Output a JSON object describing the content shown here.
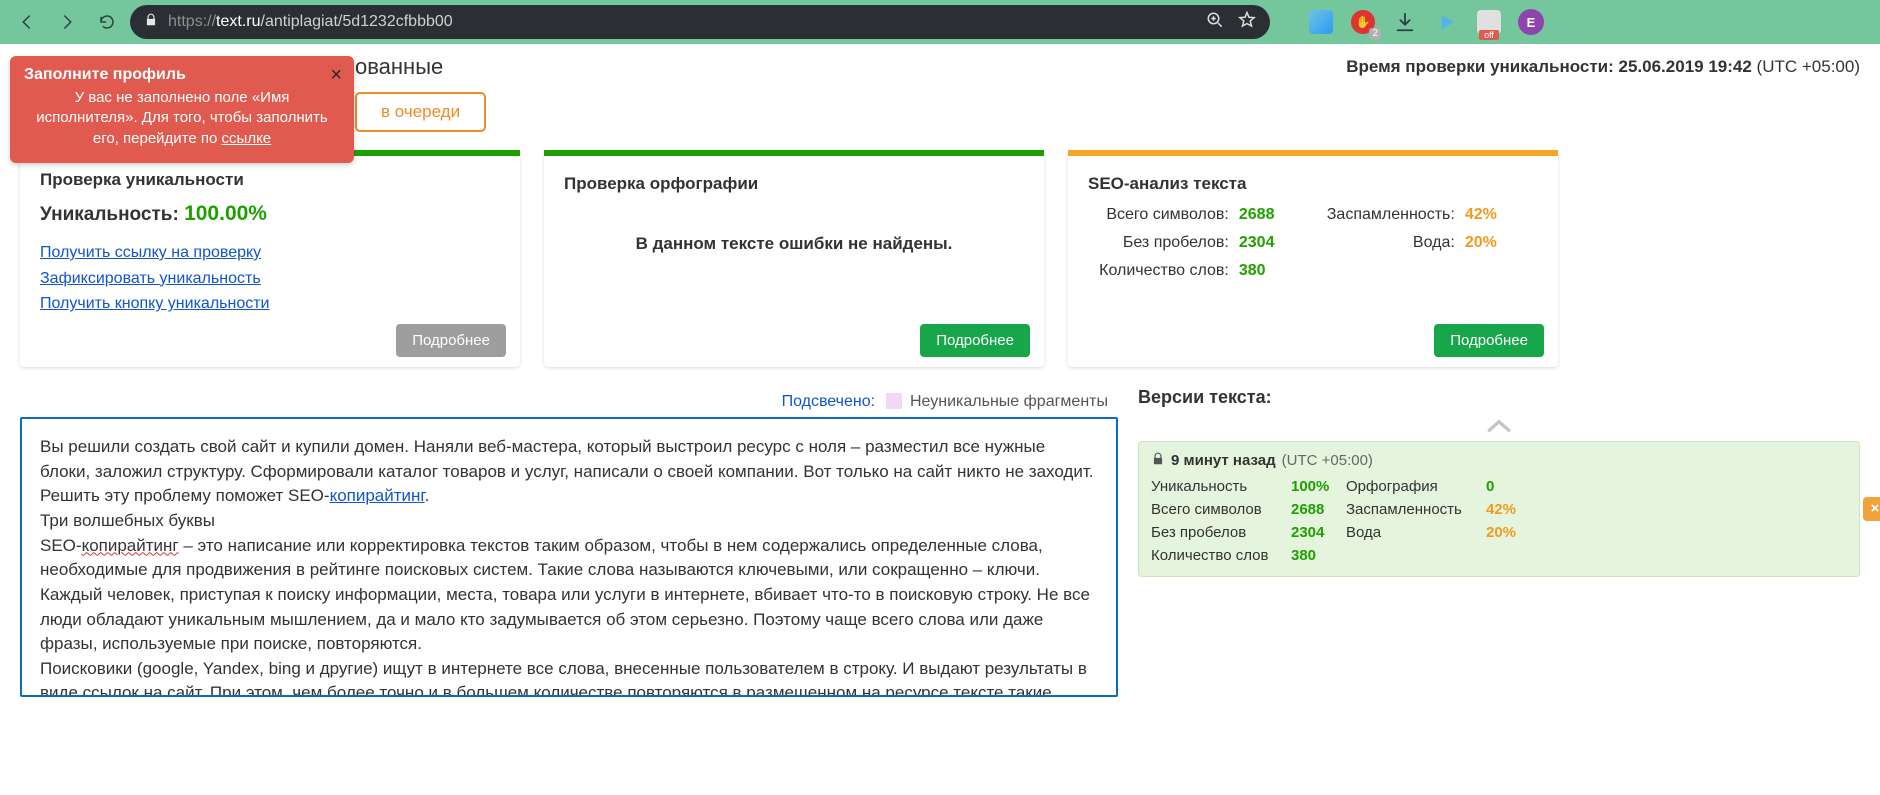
{
  "browser": {
    "url_proto": "https://",
    "url_host": "text.ru",
    "url_path": "/antiplagiat/5d1232cfbbb00",
    "ext_badge": "2",
    "ext_off": "off",
    "avatar_letter": "E"
  },
  "notif": {
    "title": "Заполните профиль",
    "body_pre": "У вас не заполнено поле «Имя исполнителя». Для того, чтобы заполнить его, перейдите по ",
    "link": "ссылке",
    "close": "×"
  },
  "top": {
    "behind": "ованные",
    "queue_btn": "в очереди",
    "check_time_label": "Время проверки уникальности: ",
    "check_time_value": "25.06.2019 19:42",
    "utc": "(UTC +05:00)"
  },
  "panel1": {
    "title": "Проверка уникальности",
    "uniq_label": "Уникальность: ",
    "uniq_value": "100.00%",
    "link1": "Получить ссылку на проверку",
    "link2": "Зафиксировать уникальность",
    "link3": "Получить кнопку уникальности",
    "details": "Подробнее"
  },
  "panel2": {
    "title": "Проверка орфографии",
    "msg": "В данном тексте ошибки не найдены.",
    "details": "Подробнее"
  },
  "panel3": {
    "title": "SEO-анализ текста",
    "rows": {
      "total_label": "Всего символов:",
      "total_val": "2688",
      "spam_label": "Заспамленность:",
      "spam_val": "42%",
      "nospace_label": "Без пробелов:",
      "nospace_val": "2304",
      "water_label": "Вода:",
      "water_val": "20%",
      "words_label": "Количество слов:",
      "words_val": "380"
    },
    "details": "Подробнее"
  },
  "legend": {
    "label": "Подсвечено:",
    "text": "Неуникальные фрагменты"
  },
  "article": {
    "p1a": "Вы решили создать свой сайт и купили домен. Наняли веб-мастера, который выстроил ресурс с ноля – разместил все нужные блоки, заложил структуру. Сформировали каталог товаров и услуг, написали о своей компании. Вот только на сайт никто не заходит. Решить эту проблему поможет SEO-",
    "p1b": "копирайтинг",
    "p1c": ".",
    "p2": "Три волшебных буквы",
    "p3a": "SEO-",
    "p3b": "копирайтинг",
    "p3c": " – это написание или корректировка текстов таким образом, чтобы в нем содержались определенные слова, необходимые для продвижения в рейтинге поисковых систем. Такие слова называются ключевыми, или сокращенно – ключи.",
    "p4": "Каждый человек, приступая к поиску информации, места, товара или услуги в интернете, вбивает что-то в поисковую строку. Не все люди обладают уникальным мышлением, да и мало кто задумывается об этом серьезно. Поэтому чаще всего слова или даже фразы, используемые при поиске, повторяются.",
    "p5": "Поисковики (google, Yandex, bing и другие) ищут в интернете все слова, внесенные пользователем в строку. И выдают результаты в виде ссылок на сайт. При этом, чем более точно и в большем количестве повторяются в размещенном на ресурсе тексте такие слова,"
  },
  "versions": {
    "title": "Версии текста:",
    "time": "9 минут назад",
    "utc": "(UTC +05:00)",
    "rows": {
      "uniq_k": "Уникальность",
      "uniq_v": "100%",
      "orth_k": "Орфография",
      "orth_v": "0",
      "total_k": "Всего символов",
      "total_v": "2688",
      "spam_k": "Заспамленность",
      "spam_v": "42%",
      "nospace_k": "Без пробелов",
      "nospace_v": "2304",
      "water_k": "Вода",
      "water_v": "20%",
      "words_k": "Количество слов",
      "words_v": "380"
    },
    "close": "×"
  }
}
